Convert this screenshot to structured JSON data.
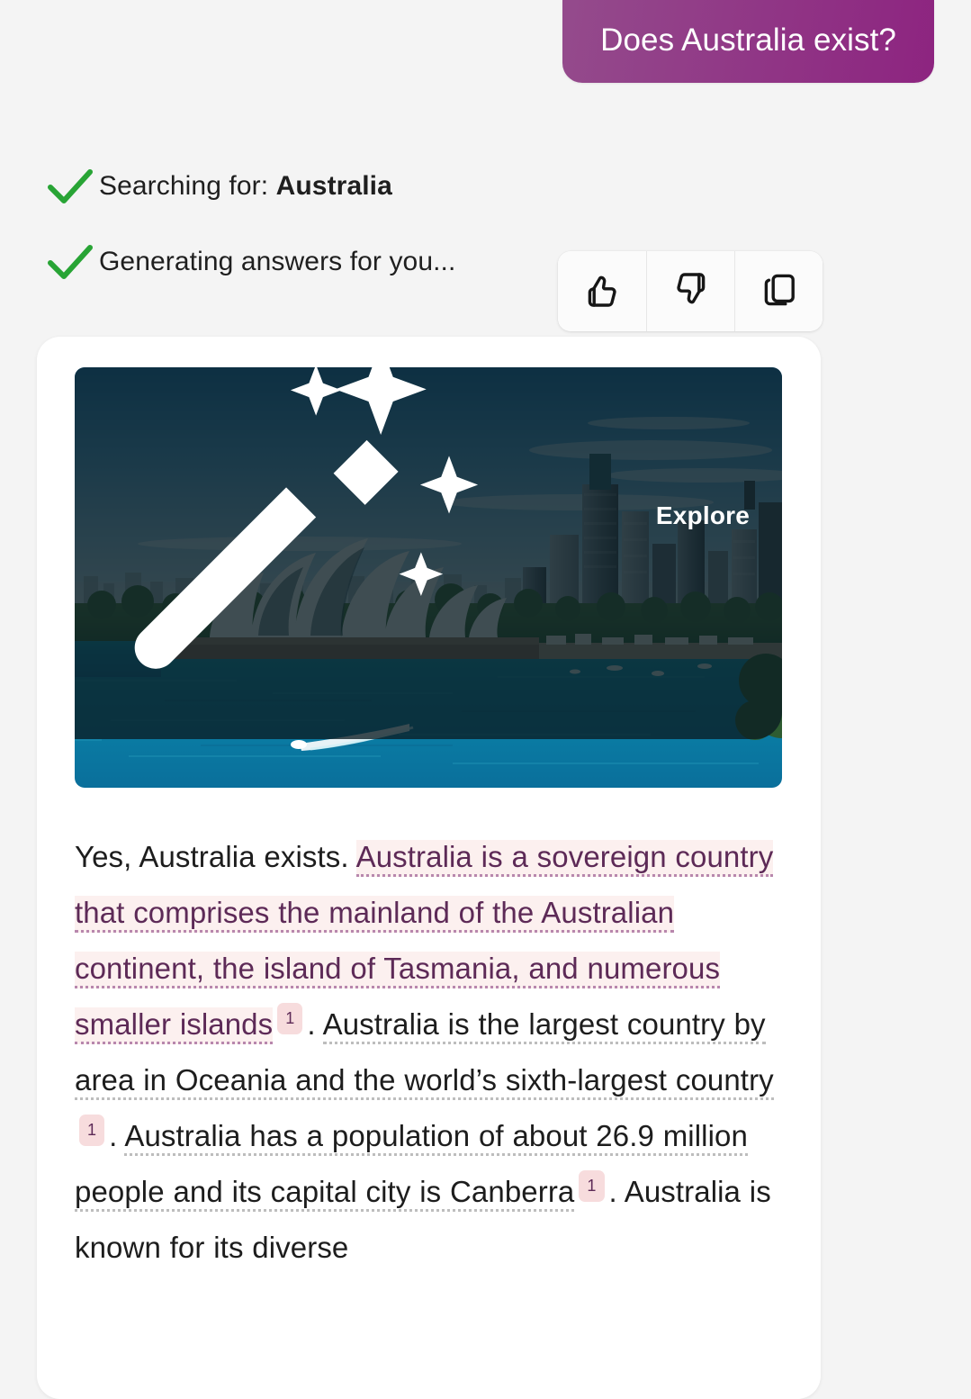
{
  "theme": {
    "page_bg": "#f4f4f4",
    "bubble_gradient_from": "#944b8c",
    "bubble_gradient_to": "#8d2480",
    "check_green": "#28a435",
    "citation_text": "#5d2a57",
    "citation_bg": "#fcf0ef",
    "citation_chip_bg": "#f7dcdd",
    "card_bg": "#ffffff"
  },
  "user_message": {
    "text": "Does Australia exist?"
  },
  "status": {
    "items": [
      {
        "icon": "check-icon",
        "prefix": "Searching for: ",
        "emphasis": "Australia",
        "suffix": ""
      },
      {
        "icon": "check-icon",
        "prefix": "Generating answers for you...",
        "emphasis": "",
        "suffix": ""
      }
    ]
  },
  "feedback": {
    "buttons": [
      {
        "name": "thumbs-up-button",
        "icon": "thumbs-up-icon",
        "label": "Thumbs up"
      },
      {
        "name": "thumbs-down-button",
        "icon": "thumbs-down-icon",
        "label": "Thumbs down"
      },
      {
        "name": "copy-button",
        "icon": "copy-icon",
        "label": "Copy"
      }
    ]
  },
  "answer_card": {
    "hero": {
      "alt": "Sydney Opera House and Sydney CBD skyline across the harbour",
      "explore_button": {
        "label": "Explore",
        "icon": "magic-wand-icon"
      }
    },
    "answer": {
      "segments": [
        {
          "type": "plain",
          "text": "Yes, Australia exists. "
        },
        {
          "type": "cited",
          "text": "Australia is a sovereign country that comprises the mainland of the Australian continent, the island of Tasmania, and numerous smaller islands"
        },
        {
          "type": "chip",
          "text": "1"
        },
        {
          "type": "plain",
          "text": ". "
        },
        {
          "type": "plain-cited",
          "text": "Australia is the largest country by area in Oceania and the world’s sixth-largest country"
        },
        {
          "type": "chip",
          "text": "1"
        },
        {
          "type": "plain",
          "text": ". "
        },
        {
          "type": "plain-cited",
          "text": "Australia has a population of about 26.9 million people and its capital city is Canberra"
        },
        {
          "type": "chip",
          "text": "1"
        },
        {
          "type": "plain",
          "text": ". "
        },
        {
          "type": "plain",
          "text": "Australia is known for its diverse"
        }
      ],
      "full_text": "Yes, Australia exists. Australia is a sovereign country that comprises the mainland of the Australian continent, the island of Tasmania, and numerous smaller islands 1 . Australia is the largest country by area in Oceania and the world’s sixth-largest country 1 . Australia has a population of about 26.9 million people and its capital city is Canberra 1 . Australia is known for its diverse"
    }
  }
}
